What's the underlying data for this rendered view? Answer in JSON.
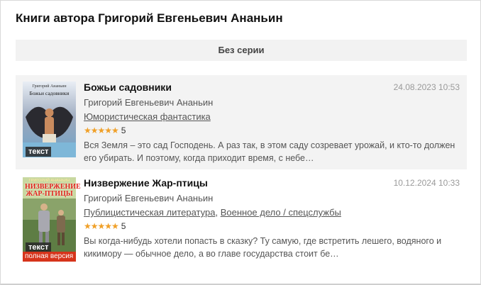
{
  "page": {
    "title": "Книги автора Григорий Евгеньевич Ананьин",
    "series_label": "Без серии"
  },
  "books": [
    {
      "title": "Божьи садовники",
      "date": "24.08.2023 10:53",
      "author": "Григорий Евгеньевич Ананьин",
      "genres": [
        "Юмористическая фантастика"
      ],
      "rating_stars": 5,
      "rating_value": "5",
      "annotation": "Вся Земля – это сад Господень. А раз так, в этом саду созревает урожай, и кто-то должен его убирать. И поэтому, когда приходит время, с небе…",
      "cover": {
        "author_line": "Григорий Ананьин",
        "title_line": "Божьи садовники",
        "badge": "текст"
      }
    },
    {
      "title": "Низвержение Жар-птицы",
      "date": "10.12.2024 10:33",
      "author": "Григорий Евгеньевич Ананьин",
      "genres": [
        "Публицистическая литература",
        "Военное дело / спецслужбы"
      ],
      "genre_separator": ",",
      "rating_stars": 5,
      "rating_value": "5",
      "annotation": "Вы когда-нибудь хотели попасть в сказку? Ту самую, где встретить лешего, водяного и кикимору — обычное дело, а во главе государства стоит бе…",
      "cover": {
        "author_line": "ГРИГОРИЙ АНАНЬИН",
        "title_line": "НИЗВЕРЖЕНИЕ ЖАР-ПТИЦЫ",
        "badge": "текст",
        "full_badge": "полная версия"
      }
    }
  ],
  "colors": {
    "accent_star": "#f0a028",
    "series_bg": "#f2f2f2",
    "badge_full": "#d6341b"
  }
}
